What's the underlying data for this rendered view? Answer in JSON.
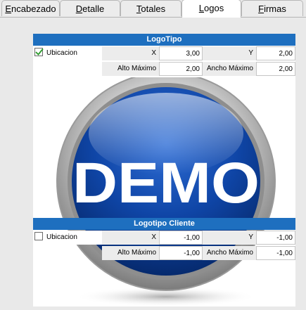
{
  "tabs": [
    {
      "pre": "",
      "u": "E",
      "post": "ncabezado"
    },
    {
      "pre": "",
      "u": "D",
      "post": "etalle"
    },
    {
      "pre": "",
      "u": "T",
      "post": "otales"
    },
    {
      "pre": "",
      "u": "L",
      "post": "ogos"
    },
    {
      "pre": "",
      "u": "F",
      "post": "irmas"
    }
  ],
  "active_tab": "Logos",
  "logotipo": {
    "title": "LogoTipo",
    "ubicacion_label": "Ubicacion",
    "ubicacion_checked": true,
    "x_label": "X",
    "x_value": "3,00",
    "y_label": "Y",
    "y_value": "2,00",
    "alto_label": "Alto Máximo",
    "alto_value": "2,00",
    "ancho_label": "Ancho Máximo",
    "ancho_value": "2,00"
  },
  "logo_image": {
    "text": "DEMO"
  },
  "logotipo_cliente": {
    "title": "Logotipo Cliente",
    "ubicacion_label": "Ubicacion",
    "ubicacion_checked": false,
    "x_label": "X",
    "x_value": "-1,00",
    "y_label": "Y",
    "y_value": "-1,00",
    "alto_label": "Alto Máximo",
    "alto_value": "-1,00",
    "ancho_label": "Ancho Máximo",
    "ancho_value": "-1,00"
  },
  "colors": {
    "header_blue": "#1e6fbf",
    "demo_blue": "#0d3f9e",
    "panel_bg": "#ffffff"
  }
}
